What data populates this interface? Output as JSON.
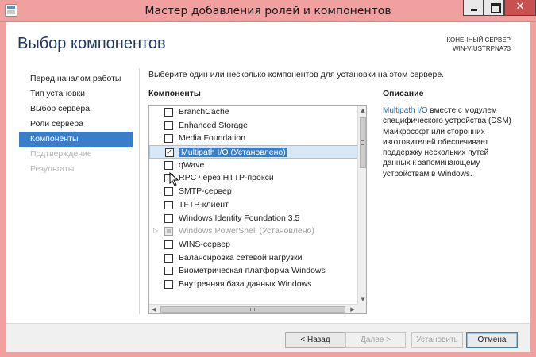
{
  "window": {
    "title": "Мастер добавления ролей и компонентов"
  },
  "header": {
    "page_title": "Выбор компонентов",
    "server_caption": "КОНЕЧНЫЙ СЕРВЕР",
    "server_name": "WIN-VIUSTRPNA73"
  },
  "nav": {
    "items": [
      {
        "label": "Перед началом работы",
        "state": "normal"
      },
      {
        "label": "Тип установки",
        "state": "normal"
      },
      {
        "label": "Выбор сервера",
        "state": "normal"
      },
      {
        "label": "Роли сервера",
        "state": "normal"
      },
      {
        "label": "Компоненты",
        "state": "active"
      },
      {
        "label": "Подтверждение",
        "state": "disabled"
      },
      {
        "label": "Результаты",
        "state": "disabled"
      }
    ]
  },
  "main": {
    "intro": "Выберите один или несколько компонентов для установки на этом сервере.",
    "features_header": "Компоненты",
    "description_header": "Описание",
    "features": [
      {
        "label": "BranchCache",
        "checked": false,
        "installed": false
      },
      {
        "label": "Enhanced Storage",
        "checked": false,
        "installed": false
      },
      {
        "label": "Media Foundation",
        "checked": false,
        "installed": false
      },
      {
        "label": "Multipath I/O (Установлено)",
        "checked": true,
        "installed": false,
        "selected": true
      },
      {
        "label": "qWave",
        "checked": false,
        "installed": false
      },
      {
        "label": "RPC через HTTP-прокси",
        "checked": false,
        "installed": false
      },
      {
        "label": "SMTP-сервер",
        "checked": false,
        "installed": false
      },
      {
        "label": "TFTP-клиент",
        "checked": false,
        "installed": false
      },
      {
        "label": "Windows Identity Foundation 3.5",
        "checked": false,
        "installed": false
      },
      {
        "label": "Windows PowerShell (Установлено)",
        "checked": true,
        "installed": true,
        "expandable": true
      },
      {
        "label": "WINS-сервер",
        "checked": false,
        "installed": false
      },
      {
        "label": "Балансировка сетевой нагрузки",
        "checked": false,
        "installed": false
      },
      {
        "label": "Биометрическая платформа Windows",
        "checked": false,
        "installed": false
      },
      {
        "label": "Внутренняя база данных Windows",
        "checked": false,
        "installed": false
      }
    ],
    "description": {
      "highlight": "Multipath I/O",
      "text": " вместе с модулем специфического устройства (DSM) Майкрософт или сторонних изготовителей обеспечивает поддержку нескольких путей данных к запоминающему устройствам в Windows."
    }
  },
  "footer": {
    "back_label": "< Назад",
    "next_label": "Далее >",
    "install_label": "Установить",
    "cancel_label": "Отмена"
  },
  "colors": {
    "titlebar": "#f1a0a0",
    "accent": "#3a7ec8",
    "title_text": "#1e395b",
    "link": "#1d6ab5"
  }
}
